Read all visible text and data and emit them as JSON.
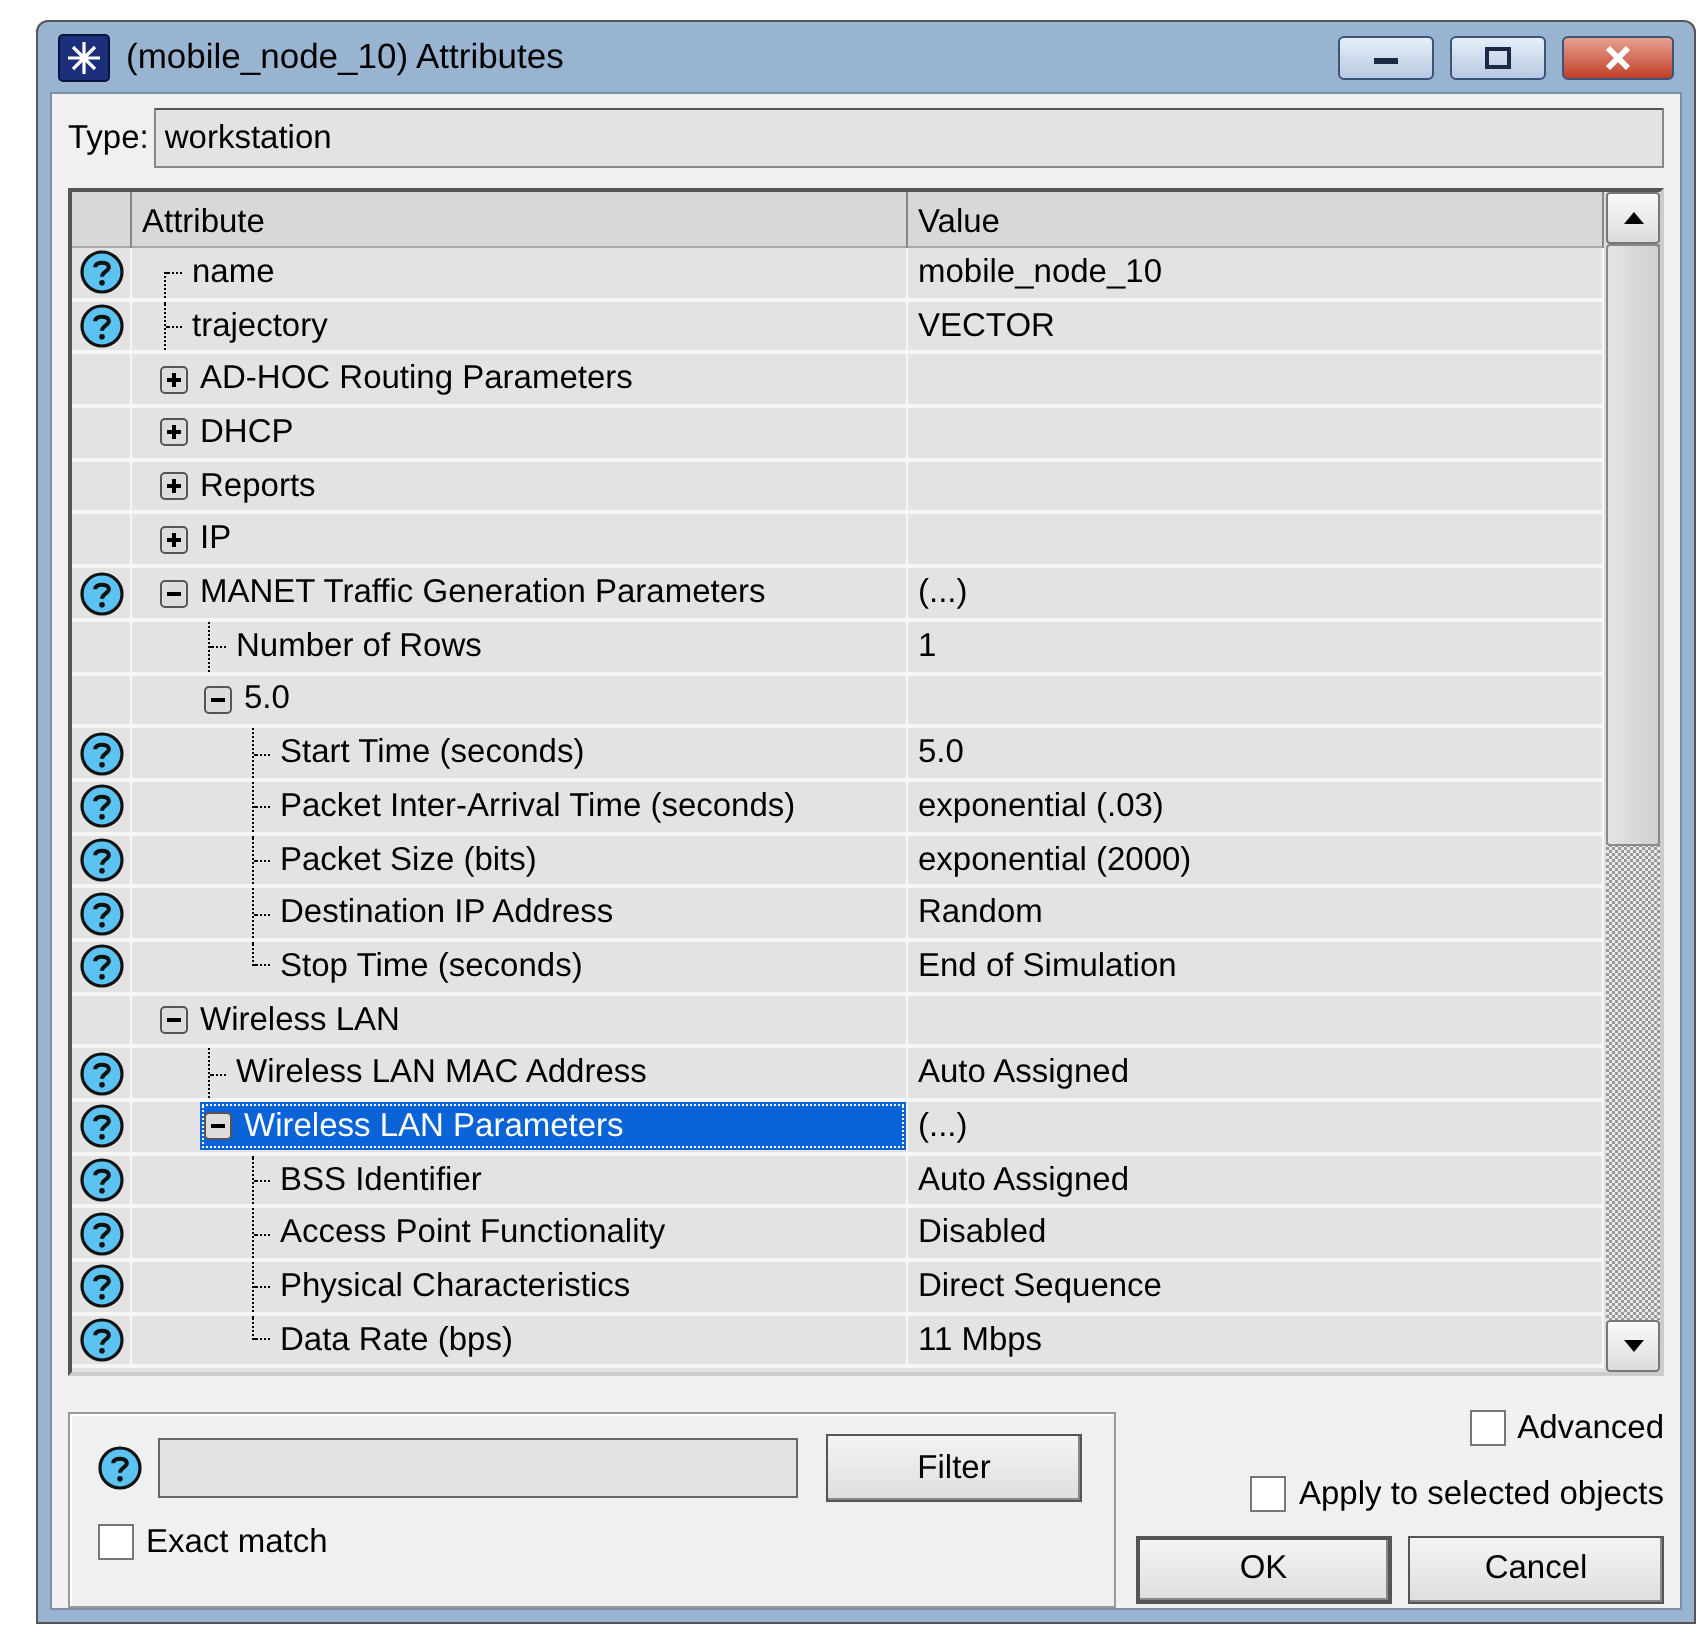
{
  "window": {
    "title": "(mobile_node_10) Attributes"
  },
  "type": {
    "label": "Type:",
    "value": "workstation"
  },
  "table": {
    "columns": [
      "Attribute",
      "Value"
    ],
    "rows": [
      {
        "name": "name",
        "value": "mobile_node_10",
        "help": true,
        "selected": false
      },
      {
        "name": "trajectory",
        "value": "VECTOR",
        "help": true,
        "selected": false
      },
      {
        "name": "AD-HOC Routing Parameters",
        "help": false,
        "expanded": false,
        "selected": false
      },
      {
        "name": "DHCP",
        "help": false,
        "expanded": false,
        "selected": false
      },
      {
        "name": "Reports",
        "help": false,
        "expanded": false,
        "selected": false
      },
      {
        "name": "IP",
        "help": false,
        "expanded": false,
        "selected": false
      },
      {
        "name": "MANET Traffic Generation Parameters",
        "value": "(...)",
        "help": true,
        "expanded": true,
        "selected": false,
        "children": [
          {
            "name": "Number of Rows",
            "value": "1",
            "help": false,
            "selected": false
          },
          {
            "name": "5.0",
            "help": false,
            "expanded": true,
            "selected": false,
            "children": [
              {
                "name": "Start Time (seconds)",
                "value": "5.0",
                "help": true,
                "selected": false
              },
              {
                "name": "Packet Inter-Arrival Time (seconds)",
                "value": "exponential (.03)",
                "help": true,
                "selected": false
              },
              {
                "name": "Packet Size (bits)",
                "value": "exponential (2000)",
                "help": true,
                "selected": false
              },
              {
                "name": "Destination IP Address",
                "value": "Random",
                "help": true,
                "selected": false
              },
              {
                "name": "Stop Time (seconds)",
                "value": "End of Simulation",
                "help": true,
                "selected": false
              }
            ]
          }
        ]
      },
      {
        "name": "Wireless LAN",
        "help": false,
        "expanded": true,
        "selected": false,
        "children": [
          {
            "name": "Wireless LAN MAC Address",
            "value": "Auto Assigned",
            "help": true,
            "selected": false
          },
          {
            "name": "Wireless LAN Parameters",
            "value": "(...)",
            "help": true,
            "expanded": true,
            "selected": true,
            "children": [
              {
                "name": "BSS Identifier",
                "value": "Auto Assigned",
                "help": true,
                "selected": false
              },
              {
                "name": "Access Point Functionality",
                "value": "Disabled",
                "help": true,
                "selected": false
              },
              {
                "name": "Physical Characteristics",
                "value": "Direct Sequence",
                "help": true,
                "selected": false
              },
              {
                "name": "Data Rate (bps)",
                "value": "11 Mbps",
                "help": true,
                "selected": false
              }
            ]
          }
        ]
      }
    ]
  },
  "filter": {
    "help": true,
    "button": {
      "label": "Filter"
    },
    "exact_match": {
      "label": "Exact match",
      "checked": false
    }
  },
  "advanced": {
    "label": "Advanced",
    "checked": false
  },
  "apply_to_selected": {
    "label": "Apply to selected objects",
    "checked": false
  },
  "buttons": [
    {
      "label": "OK"
    },
    {
      "label": "Cancel"
    }
  ]
}
